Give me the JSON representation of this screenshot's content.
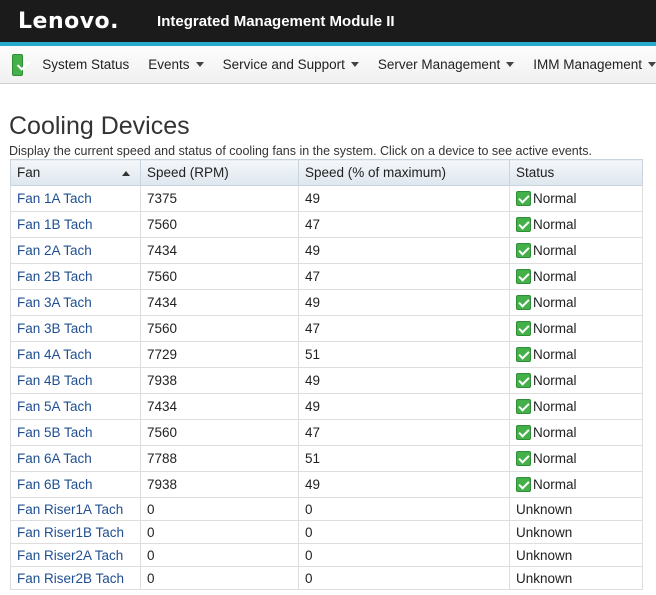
{
  "header": {
    "brand": "Lenovo.",
    "app_title": "Integrated Management Module II"
  },
  "nav": {
    "status_icon": "check-icon",
    "items": [
      {
        "label": "System Status",
        "dropdown": false
      },
      {
        "label": "Events",
        "dropdown": true
      },
      {
        "label": "Service and Support",
        "dropdown": true
      },
      {
        "label": "Server Management",
        "dropdown": true
      },
      {
        "label": "IMM Management",
        "dropdown": true
      }
    ]
  },
  "page": {
    "title": "Cooling Devices",
    "description": "Display the current speed and status of cooling fans in the system. Click on a device to see active events."
  },
  "table": {
    "headers": [
      "Fan",
      "Speed (RPM)",
      "Speed (% of maximum)",
      "Status"
    ],
    "sorted_column": "Fan",
    "sort_direction": "ascending",
    "rows": [
      {
        "fan": "Fan 1A Tach",
        "rpm": "7375",
        "percent": "49",
        "status": "Normal",
        "ok": true
      },
      {
        "fan": "Fan 1B Tach",
        "rpm": "7560",
        "percent": "47",
        "status": "Normal",
        "ok": true
      },
      {
        "fan": "Fan 2A Tach",
        "rpm": "7434",
        "percent": "49",
        "status": "Normal",
        "ok": true
      },
      {
        "fan": "Fan 2B Tach",
        "rpm": "7560",
        "percent": "47",
        "status": "Normal",
        "ok": true
      },
      {
        "fan": "Fan 3A Tach",
        "rpm": "7434",
        "percent": "49",
        "status": "Normal",
        "ok": true
      },
      {
        "fan": "Fan 3B Tach",
        "rpm": "7560",
        "percent": "47",
        "status": "Normal",
        "ok": true
      },
      {
        "fan": "Fan 4A Tach",
        "rpm": "7729",
        "percent": "51",
        "status": "Normal",
        "ok": true
      },
      {
        "fan": "Fan 4B Tach",
        "rpm": "7938",
        "percent": "49",
        "status": "Normal",
        "ok": true
      },
      {
        "fan": "Fan 5A Tach",
        "rpm": "7434",
        "percent": "49",
        "status": "Normal",
        "ok": true
      },
      {
        "fan": "Fan 5B Tach",
        "rpm": "7560",
        "percent": "47",
        "status": "Normal",
        "ok": true
      },
      {
        "fan": "Fan 6A Tach",
        "rpm": "7788",
        "percent": "51",
        "status": "Normal",
        "ok": true
      },
      {
        "fan": "Fan 6B Tach",
        "rpm": "7938",
        "percent": "49",
        "status": "Normal",
        "ok": true
      },
      {
        "fan": "Fan Riser1A Tach",
        "rpm": "0",
        "percent": "0",
        "status": "Unknown",
        "ok": false
      },
      {
        "fan": "Fan Riser1B Tach",
        "rpm": "0",
        "percent": "0",
        "status": "Unknown",
        "ok": false
      },
      {
        "fan": "Fan Riser2A Tach",
        "rpm": "0",
        "percent": "0",
        "status": "Unknown",
        "ok": false
      },
      {
        "fan": "Fan Riser2B Tach",
        "rpm": "0",
        "percent": "0",
        "status": "Unknown",
        "ok": false
      }
    ]
  },
  "colors": {
    "header_bg": "#1b1b1b",
    "accent": "#2aa9cf",
    "link": "#1f4f92",
    "ok_green": "#43b049"
  }
}
